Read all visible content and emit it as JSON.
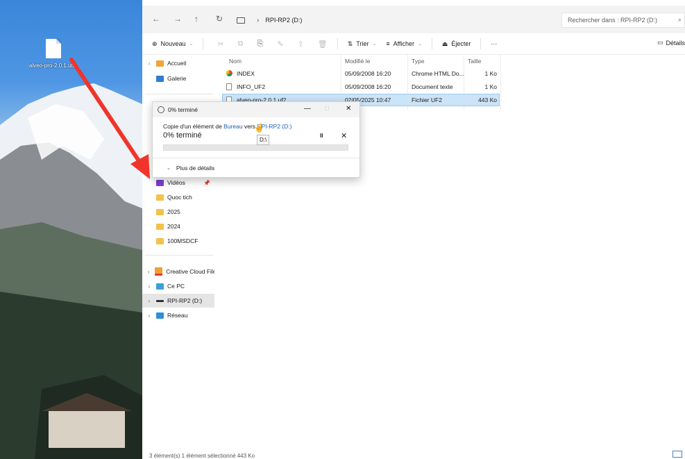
{
  "desktop": {
    "file_label": "alveo-pro-2.0.1.uf2"
  },
  "address": {
    "path": "RPI-RP2 (D:)"
  },
  "search": {
    "placeholder": "Rechercher dans : RPI-RP2 (D:)"
  },
  "toolbar": {
    "new_label": "Nouveau",
    "sort_label": "Trier",
    "view_label": "Afficher",
    "eject_label": "Éjecter",
    "more_label": "···",
    "details_label": "Détails"
  },
  "sidebar": {
    "top": [
      {
        "label": "Accueil",
        "icon": "home-icon"
      },
      {
        "label": "Galerie",
        "icon": "gallery-icon"
      }
    ],
    "quick": [
      {
        "label": "Vidéos",
        "icon": "videos-icon"
      },
      {
        "label": "Quoc tich",
        "icon": "folder-icon"
      },
      {
        "label": "2025",
        "icon": "folder-icon"
      },
      {
        "label": "2024",
        "icon": "folder-icon"
      },
      {
        "label": "100MSDCF",
        "icon": "folder-icon"
      }
    ],
    "places": [
      {
        "label": "Creative Cloud Files",
        "icon": "creative-cloud-icon"
      },
      {
        "label": "Ce PC",
        "icon": "pc-icon"
      },
      {
        "label": "RPI-RP2 (D:)",
        "icon": "drive-icon"
      },
      {
        "label": "Réseau",
        "icon": "network-icon"
      }
    ]
  },
  "columns": {
    "name": "Nom",
    "modified": "Modifié le",
    "type": "Type",
    "size": "Taille"
  },
  "files": [
    {
      "name": "INDEX",
      "modified": "05/09/2008 16:20",
      "type": "Chrome HTML Do...",
      "size": "1 Ko"
    },
    {
      "name": "INFO_UF2",
      "modified": "05/09/2008 16:20",
      "type": "Document texte",
      "size": "1 Ko"
    },
    {
      "name": "alveo-pro-2.0.1.uf2",
      "modified": "02/05/2025 10:47",
      "type": "Fichier UF2",
      "size": "443 Ko"
    }
  ],
  "status": {
    "text": "3 élément(s)    1 élément sélectionné  443 Ko"
  },
  "dialog": {
    "title": "0% terminé",
    "copy_prefix": "Copie d'un élément de",
    "source": "Bureau",
    "copy_mid": "vers",
    "destination": "RPI-RP2 (D:)",
    "percent_text": "0% terminé",
    "progress": 0,
    "tooltip": "D:\\",
    "more_details": "Plus de détails",
    "pause_symbol": "II",
    "cancel_symbol": "✕",
    "minimize_symbol": "—",
    "close_symbol": "✕"
  },
  "colors": {
    "accent": "#1a5fb4",
    "selection": "#cce4f7",
    "progress": "#06b025",
    "annotation_arrow": "#f0342b"
  }
}
